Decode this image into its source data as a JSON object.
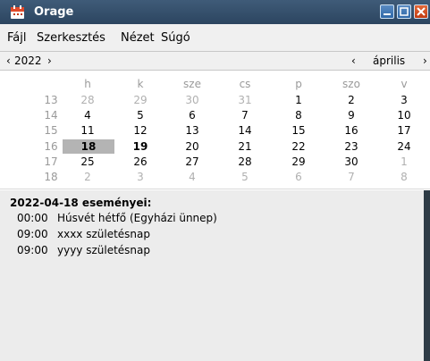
{
  "window": {
    "title": "Orage",
    "icon": "calendar-icon"
  },
  "menu": [
    "Fájl",
    "Szerkesztés",
    "Nézet",
    "Súgó"
  ],
  "nav": {
    "year_prev": "‹",
    "year": "2022",
    "year_next": "›",
    "month_prev": "‹",
    "month": "április",
    "month_next": "›"
  },
  "calendar": {
    "headers": [
      "h",
      "k",
      "sze",
      "cs",
      "p",
      "szo",
      "v"
    ],
    "weeks": [
      {
        "wk": "13",
        "days": [
          "28",
          "29",
          "30",
          "31",
          "1",
          "2",
          "3"
        ]
      },
      {
        "wk": "14",
        "days": [
          "4",
          "5",
          "6",
          "7",
          "8",
          "9",
          "10"
        ]
      },
      {
        "wk": "15",
        "days": [
          "11",
          "12",
          "13",
          "14",
          "15",
          "16",
          "17"
        ]
      },
      {
        "wk": "16",
        "days": [
          "18",
          "19",
          "20",
          "21",
          "22",
          "23",
          "24"
        ]
      },
      {
        "wk": "17",
        "days": [
          "25",
          "26",
          "27",
          "28",
          "29",
          "30",
          "1"
        ]
      },
      {
        "wk": "18",
        "days": [
          "2",
          "3",
          "4",
          "5",
          "6",
          "7",
          "8"
        ]
      }
    ]
  },
  "events": {
    "title": "2022-04-18 eseményei:",
    "items": [
      {
        "time": "00:00",
        "text": "Húsvét hétfő (Egyházi ünnep)"
      },
      {
        "time": "09:00",
        "text": "xxxx születésnap"
      },
      {
        "time": "09:00",
        "text": "yyyy születésnap"
      }
    ]
  }
}
